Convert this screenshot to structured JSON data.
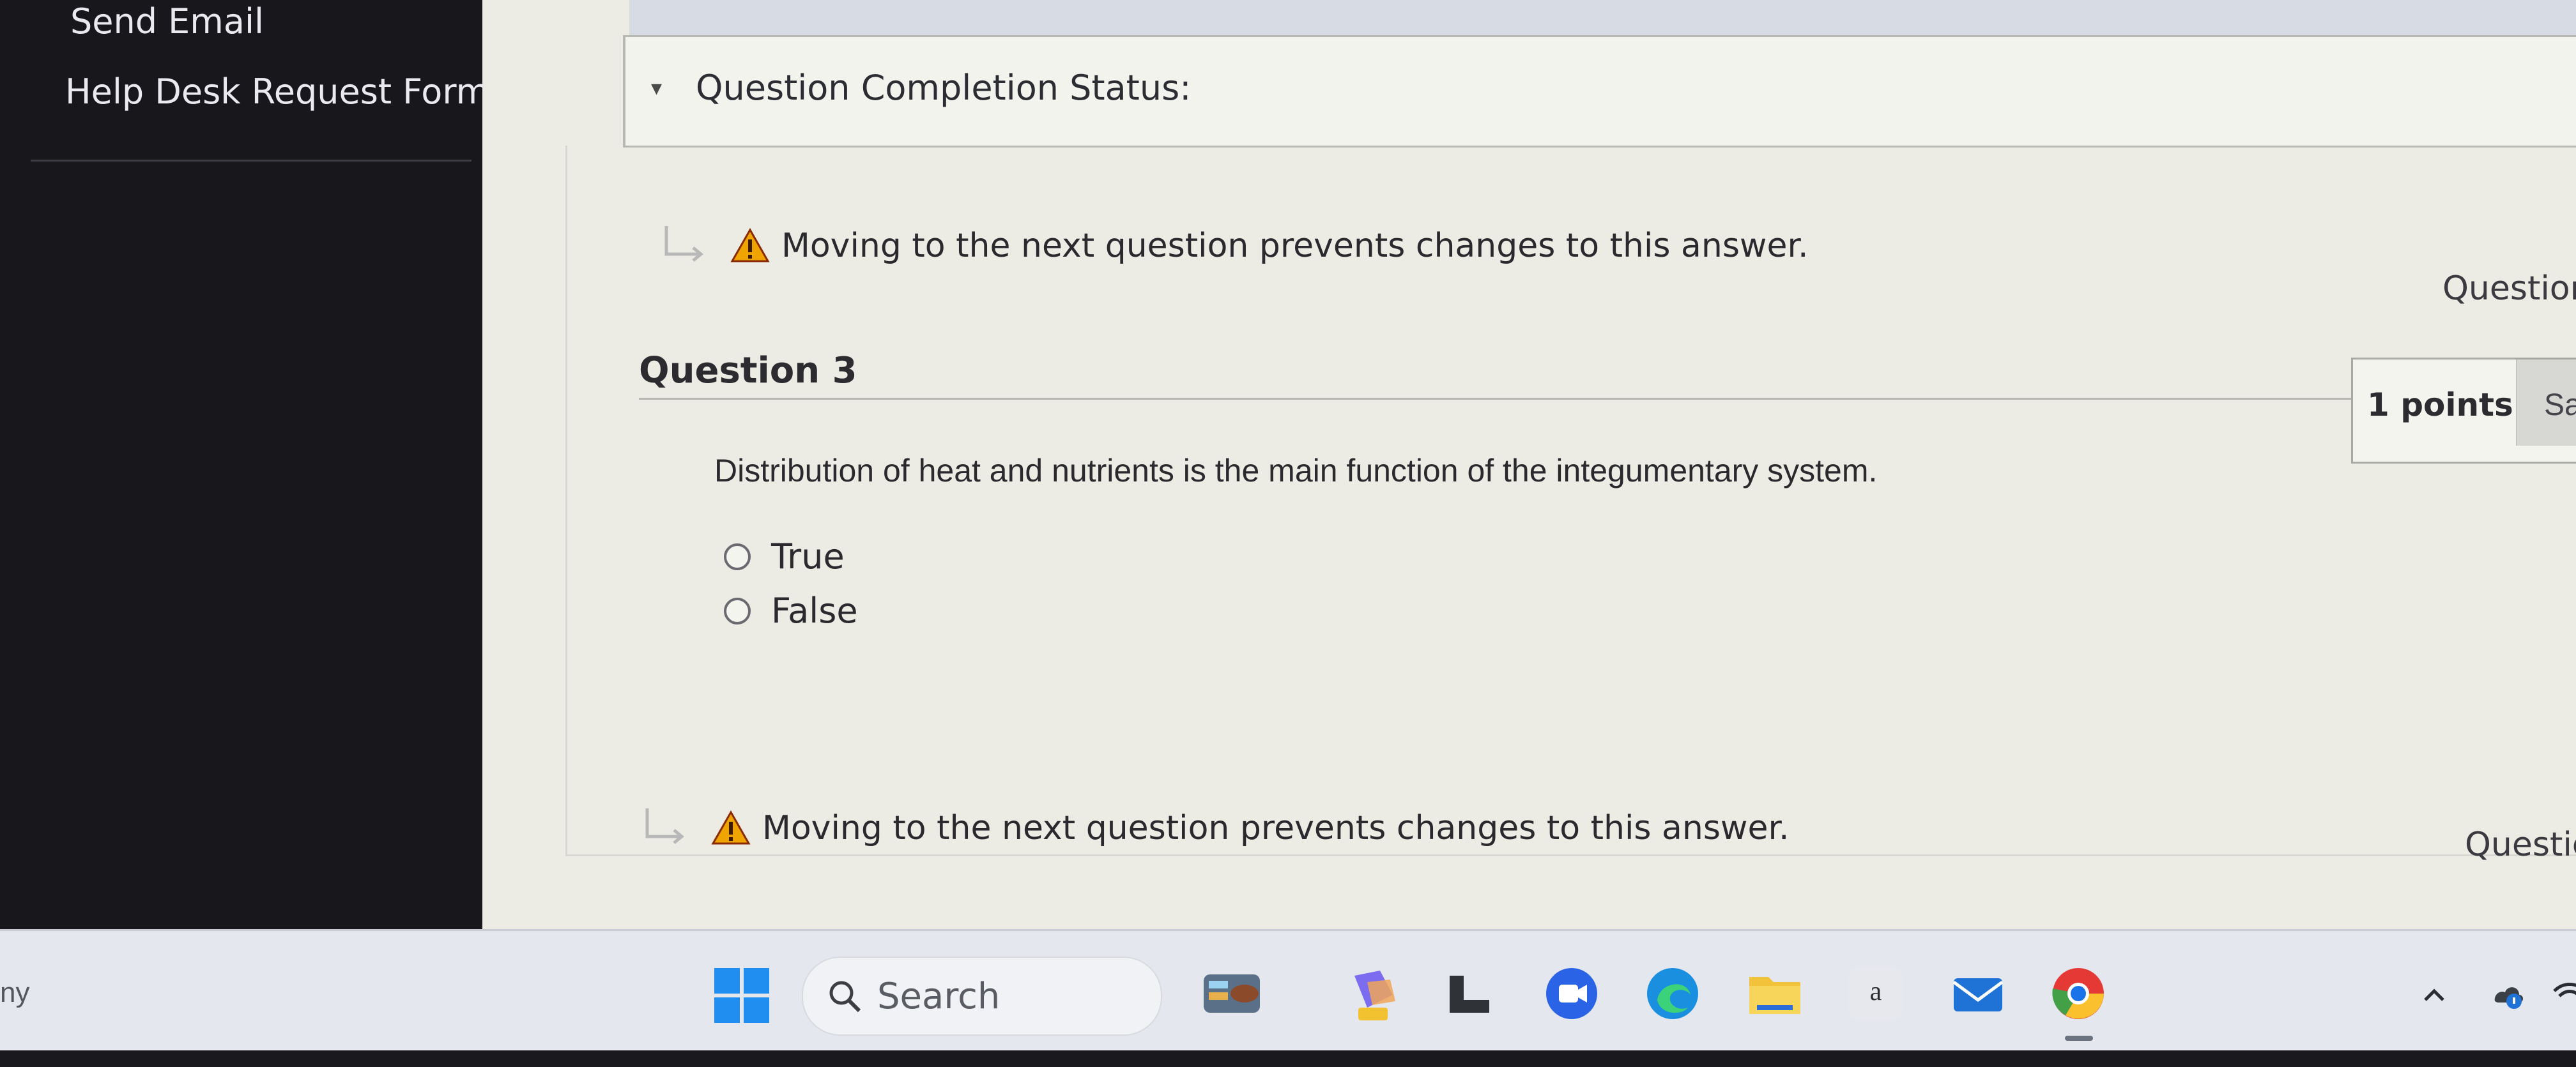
{
  "sidebar": {
    "links": [
      "Send Email",
      "Help Desk Request Form"
    ]
  },
  "status": {
    "label": "Question Completion Status:"
  },
  "warning": {
    "text": "Moving to the next question prevents changes to this answer.",
    "question_link": "Question",
    "question_link_bottom": "Questic"
  },
  "question": {
    "title": "Question 3",
    "points": "1 points",
    "save_label": "Sa",
    "text": "Distribution of heat and nutrients is the main function of the integumentary system.",
    "options": [
      "True",
      "False"
    ],
    "selected": null
  },
  "taskbar": {
    "left_text": "ny",
    "search_label": "Search",
    "apps": [
      "widgets-icon",
      "copilot-icon",
      "file-icon",
      "teams-icon",
      "edge-icon",
      "file-explorer-icon",
      "amazon-icon",
      "mail-icon",
      "chrome-icon"
    ],
    "tray": [
      "chevron-up-icon",
      "onedrive-icon",
      "wifi-icon"
    ]
  },
  "colors": {
    "warning": "#f0a400",
    "accent_blue": "#1a73e8",
    "background": "#ecebe4"
  }
}
